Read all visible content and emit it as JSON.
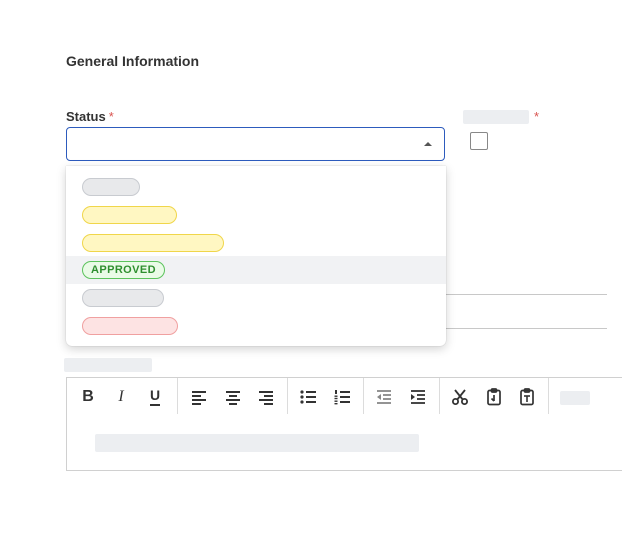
{
  "section": {
    "title": "General Information"
  },
  "status_field": {
    "label": "Status",
    "required_mark": "*",
    "value": "",
    "options": [
      {
        "label": "",
        "color": "gray"
      },
      {
        "label": "",
        "color": "yellow"
      },
      {
        "label": "",
        "color": "yellow"
      },
      {
        "label": "APPROVED",
        "color": "green"
      },
      {
        "label": "",
        "color": "gray"
      },
      {
        "label": "",
        "color": "red"
      }
    ]
  },
  "second_field": {
    "required_mark": "*",
    "checked": false
  },
  "editor": {
    "toolbar": {
      "bold": "B",
      "italic": "I",
      "underline": "U"
    }
  },
  "colors": {
    "accent": "#2d5bbd",
    "required": "#d9534f",
    "approved_text": "#2f8f2f"
  }
}
